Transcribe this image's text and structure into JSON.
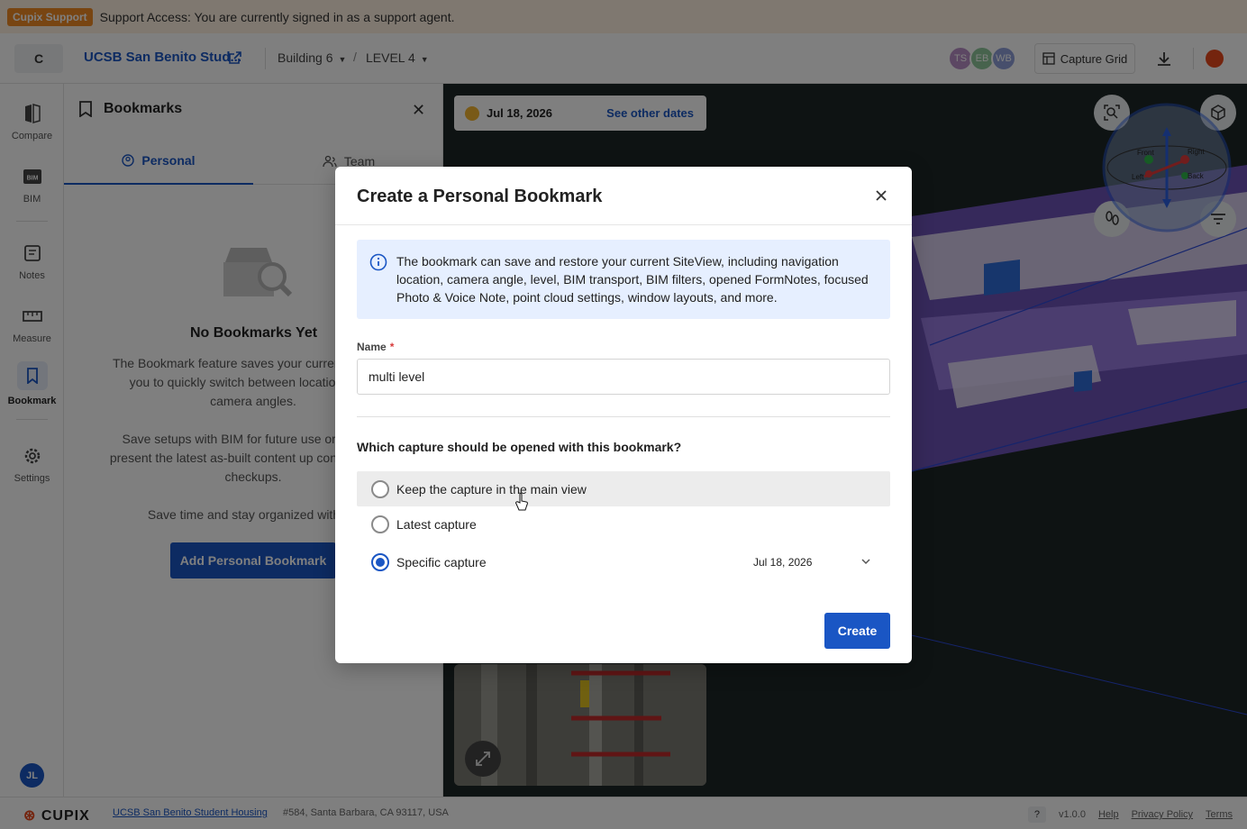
{
  "support": {
    "badge": "Cupix Support",
    "message": "Support Access: You are currently signed in as a support agent."
  },
  "header": {
    "project_initial": "C",
    "project_name": "UCSB San Benito Stud...",
    "building": "Building 6",
    "level": "LEVEL 4",
    "separator": "/",
    "avatars": [
      {
        "initials": "TS",
        "color": "#b98fc7"
      },
      {
        "initials": "EB",
        "color": "#8ec79a"
      },
      {
        "initials": "WB",
        "color": "#8f9fd8"
      }
    ],
    "capture_grid_label": "Capture Grid"
  },
  "rail": {
    "items": [
      {
        "label": "Compare",
        "icon": "compare-icon"
      },
      {
        "label": "BIM",
        "icon": "bim-icon"
      },
      {
        "label": "Notes",
        "icon": "notes-icon"
      },
      {
        "label": "Measure",
        "icon": "measure-icon"
      },
      {
        "label": "Bookmark",
        "icon": "bookmark-icon"
      },
      {
        "label": "Settings",
        "icon": "gear-icon"
      }
    ],
    "user_initials": "JL"
  },
  "panel": {
    "title": "Bookmarks",
    "tabs": [
      {
        "label": "Personal"
      },
      {
        "label": "Team"
      }
    ],
    "empty_title": "No Bookmarks Yet",
    "empty_paragraphs": [
      "The Bookmark feature saves your current allowing you to quickly switch between locations, and camera angles.",
      "Save setups with BIM for future use or sharing, present the latest as-built content up consistent site checkups.",
      "Save time and stay organized with Bo"
    ],
    "add_button": "Add Personal Bookmark"
  },
  "viewer": {
    "capture_date": "Jul 18, 2026",
    "see_other_dates": "See other dates",
    "cube_labels": [
      "Front",
      "Right",
      "Left",
      "Back"
    ]
  },
  "modal": {
    "title": "Create a Personal Bookmark",
    "info": "The bookmark can save and restore your current SiteView, including navigation location, camera angle, level, BIM transport, BIM filters, opened FormNotes, focused Photo & Voice Note, point cloud settings, window layouts, and more.",
    "name_label": "Name",
    "required_mark": "*",
    "name_value": "multi level",
    "question": "Which capture should be opened with this bookmark?",
    "options": [
      {
        "label": "Keep the capture in the main view",
        "selected": false
      },
      {
        "label": "Latest capture",
        "selected": false
      },
      {
        "label": "Specific capture",
        "selected": true
      }
    ],
    "specific_date": "Jul 18, 2026",
    "create_button": "Create"
  },
  "footer": {
    "logo": "CUPIX",
    "project_link": "UCSB San Benito Student Housing",
    "address": "#584, Santa Barbara, CA 93117, USA",
    "help_q": "?",
    "version": "v1.0.0",
    "help": "Help",
    "privacy": "Privacy Policy",
    "terms": "Terms"
  },
  "colors": {
    "accent": "#1a56c4",
    "support_badge": "#f08a24",
    "point_cloud": "#9b6fe0"
  }
}
